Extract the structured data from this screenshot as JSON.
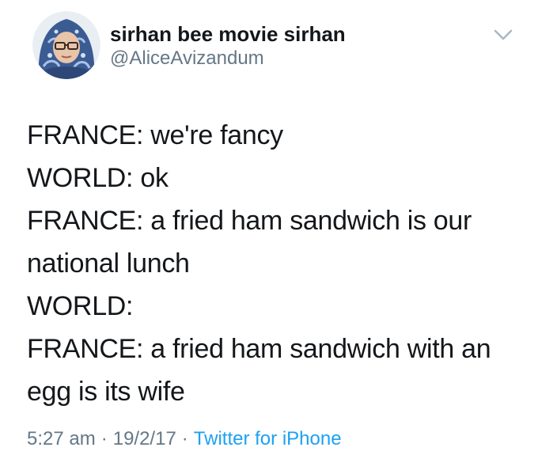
{
  "author": {
    "display_name": "sirhan bee movie sirhan",
    "handle": "@AliceAvizandum"
  },
  "tweet": {
    "lines": [
      "FRANCE: we're fancy",
      "WORLD: ok",
      "FRANCE: a fried ham sandwich is our",
      "national lunch",
      "WORLD:",
      "FRANCE: a fried ham sandwich with an",
      "egg is its wife"
    ]
  },
  "meta": {
    "time": "5:27 am",
    "separator": "·",
    "date": "19/2/17",
    "source": "Twitter for iPhone"
  },
  "icons": {
    "menu": "chevron-down-icon",
    "avatar": "avatar"
  },
  "colors": {
    "text": "#14171a",
    "secondary": "#657786",
    "link": "#1da1f2",
    "background": "#ffffff"
  }
}
